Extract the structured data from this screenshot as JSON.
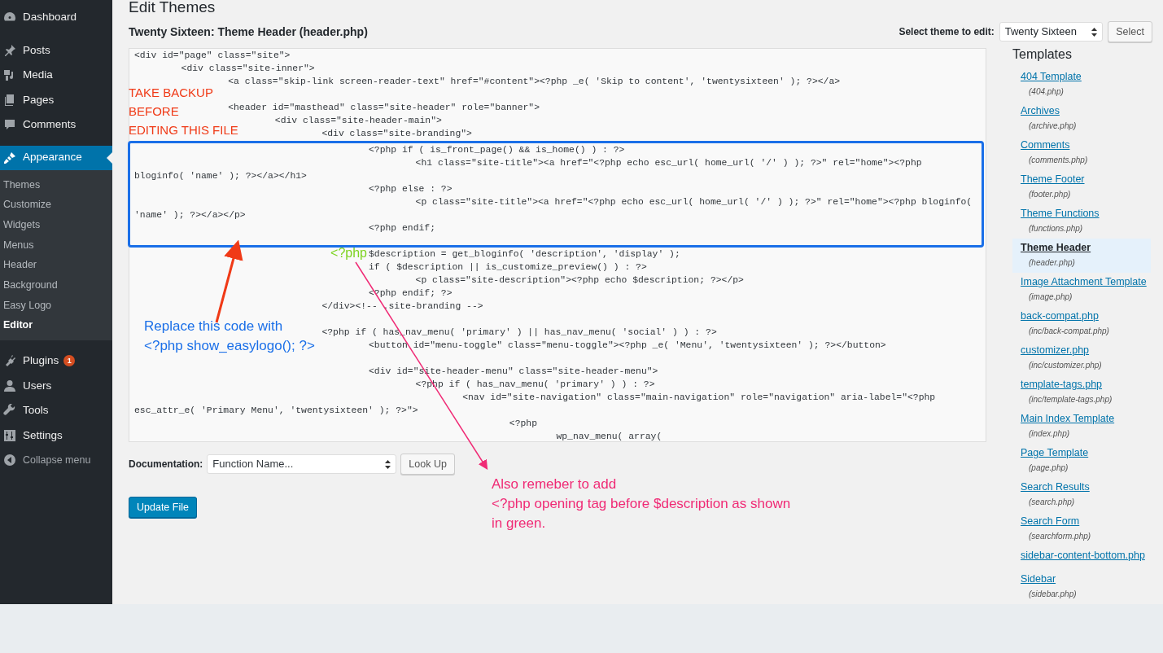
{
  "sidebar": {
    "items": [
      {
        "label": "Dashboard",
        "selected": false
      },
      {
        "label": "Posts",
        "selected": false
      },
      {
        "label": "Media",
        "selected": false
      },
      {
        "label": "Pages",
        "selected": false
      },
      {
        "label": "Comments",
        "selected": false
      },
      {
        "label": "Appearance",
        "selected": true,
        "children": [
          {
            "label": "Themes",
            "selected": false
          },
          {
            "label": "Customize",
            "selected": false
          },
          {
            "label": "Widgets",
            "selected": false
          },
          {
            "label": "Menus",
            "selected": false
          },
          {
            "label": "Header",
            "selected": false
          },
          {
            "label": "Background",
            "selected": false
          },
          {
            "label": "Easy Logo",
            "selected": false
          },
          {
            "label": "Editor",
            "selected": true
          }
        ]
      },
      {
        "label": "Plugins",
        "selected": false,
        "badge": "1"
      },
      {
        "label": "Users",
        "selected": false
      },
      {
        "label": "Tools",
        "selected": false
      },
      {
        "label": "Settings",
        "selected": false
      },
      {
        "label": "Collapse menu",
        "selected": false
      }
    ]
  },
  "page_title": "Edit Themes",
  "file_title": "Twenty Sixteen: Theme Header (header.php)",
  "theme_select": {
    "label": "Select theme to edit:",
    "value": "Twenty Sixteen",
    "button": "Select"
  },
  "editor": {
    "blocks": [
      {
        "highlighted": false,
        "lines": [
          {
            "text": "<div id=\"page\" class=\"site\">"
          },
          {
            "text": "\t<div class=\"site-inner\">"
          },
          {
            "text": "\t\t<a class=\"skip-link screen-reader-text\" href=\"#content\"><?php _e( 'Skip to content', 'twentysixteen' ); ?></a>"
          },
          {
            "text": "\t\t<header id=\"masthead\" class=\"site-header\" role=\"banner\">",
            "gap_before": true
          },
          {
            "text": "\t\t\t<div class=\"site-header-main\">"
          },
          {
            "text": "\t\t\t\t<div class=\"site-branding\">"
          }
        ]
      },
      {
        "highlighted": true,
        "lines": [
          {
            "text": "\t\t\t\t\t<?php if ( is_front_page() && is_home() ) : ?>"
          },
          {
            "text": "\t\t\t\t\t\t<h1 class=\"site-title\"><a href=\"<?php echo esc_url( home_url( '/' ) ); ?>\" rel=\"home\"><?php"
          },
          {
            "text": "bloginfo( 'name' ); ?></a></h1>"
          },
          {
            "text": "\t\t\t\t\t<?php else : ?>"
          },
          {
            "text": "\t\t\t\t\t\t<p class=\"site-title\"><a href=\"<?php echo esc_url( home_url( '/' ) ); ?>\" rel=\"home\"><?php bloginfo("
          },
          {
            "text": "'name' ); ?></a></p>"
          },
          {
            "text": "\t\t\t\t\t<?php endif;"
          }
        ]
      },
      {
        "highlighted": false,
        "lines": [
          {
            "text": "\t\t\t\t\t$description = get_bloginfo( 'description', 'display' );",
            "insert": "<?php"
          },
          {
            "text": "\t\t\t\t\tif ( $description || is_customize_preview() ) : ?>"
          },
          {
            "text": "\t\t\t\t\t\t<p class=\"site-description\"><?php echo $description; ?></p>"
          },
          {
            "text": "\t\t\t\t\t<?php endif; ?>"
          },
          {
            "text": "\t\t\t\t</div><!-- .site-branding -->"
          },
          {
            "text": "\t\t\t\t<?php if ( has_nav_menu( 'primary' ) || has_nav_menu( 'social' ) ) : ?>",
            "gap_before": true
          },
          {
            "text": "\t\t\t\t\t<button id=\"menu-toggle\" class=\"menu-toggle\"><?php _e( 'Menu', 'twentysixteen' ); ?></button>"
          },
          {
            "text": "\t\t\t\t\t<div id=\"site-header-menu\" class=\"site-header-menu\">",
            "gap_before": true
          },
          {
            "text": "\t\t\t\t\t\t<?php if ( has_nav_menu( 'primary' ) ) : ?>"
          },
          {
            "text": "\t\t\t\t\t\t\t<nav id=\"site-navigation\" class=\"main-navigation\" role=\"navigation\" aria-label=\"<?php"
          },
          {
            "text": "esc_attr_e( 'Primary Menu', 'twentysixteen' ); ?>\">"
          },
          {
            "text": "\t\t\t\t\t\t\t\t<?php"
          },
          {
            "text": "\t\t\t\t\t\t\t\t\twp_nav_menu( array("
          }
        ]
      }
    ]
  },
  "documentation": {
    "label": "Documentation:",
    "placeholder": "Function Name...",
    "button": "Look Up"
  },
  "update_button": "Update File",
  "templates": {
    "title": "Templates",
    "items": [
      {
        "name": "404 Template",
        "file": "(404.php)",
        "selected": false
      },
      {
        "name": "Archives",
        "file": "(archive.php)",
        "selected": false
      },
      {
        "name": "Comments",
        "file": "(comments.php)",
        "selected": false
      },
      {
        "name": "Theme Footer",
        "file": "(footer.php)",
        "selected": false
      },
      {
        "name": "Theme Functions",
        "file": "(functions.php)",
        "selected": false
      },
      {
        "name": "Theme Header",
        "file": "(header.php)",
        "selected": true
      },
      {
        "name": "Image Attachment Template",
        "file": "(image.php)",
        "selected": false
      },
      {
        "name": "back-compat.php",
        "file": "(inc/back-compat.php)",
        "selected": false
      },
      {
        "name": "customizer.php",
        "file": "(inc/customizer.php)",
        "selected": false
      },
      {
        "name": "template-tags.php",
        "file": "(inc/template-tags.php)",
        "selected": false
      },
      {
        "name": "Main Index Template",
        "file": "(index.php)",
        "selected": false
      },
      {
        "name": "Page Template",
        "file": "(page.php)",
        "selected": false
      },
      {
        "name": "Search Results",
        "file": "(search.php)",
        "selected": false
      },
      {
        "name": "Search Form",
        "file": "(searchform.php)",
        "selected": false
      },
      {
        "name": "sidebar-content-bottom.php",
        "selected": false
      },
      {
        "name": "Sidebar",
        "file": "(sidebar.php)",
        "selected": false
      }
    ]
  },
  "annotations": [
    {
      "kind": "warning",
      "lines": [
        "TAKE BACKUP",
        "BEFORE",
        "EDITING THIS FILE"
      ]
    },
    {
      "kind": "replace",
      "lines": [
        "Replace this code with",
        "<?php show_easylogo(); ?>"
      ]
    },
    {
      "kind": "note",
      "lines": [
        "Also remeber to add",
        "<?php opening tag before $description as shown",
        "in green."
      ]
    }
  ]
}
